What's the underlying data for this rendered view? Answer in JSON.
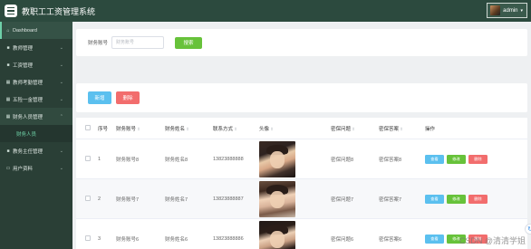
{
  "header": {
    "title": "教职工工资管理系统",
    "user": "admin",
    "caret": "▾"
  },
  "sidebar": {
    "items": [
      {
        "icon": "⌂",
        "label": "Dashboard",
        "chevron": ""
      },
      {
        "icon": "■",
        "label": "教师管理",
        "chevron": "⌄"
      },
      {
        "icon": "■",
        "label": "工资管理",
        "chevron": "⌄"
      },
      {
        "icon": "▦",
        "label": "教师考勤管理",
        "chevron": "⌄"
      },
      {
        "icon": "▦",
        "label": "五险一金管理",
        "chevron": "⌄"
      },
      {
        "icon": "▦",
        "label": "财务人员管理",
        "chevron": "⌃"
      },
      {
        "icon": "",
        "label": "财务人员",
        "chevron": ""
      },
      {
        "icon": "■",
        "label": "教务主任管理",
        "chevron": "⌄"
      },
      {
        "icon": "▭",
        "label": "用户资料",
        "chevron": "⌄"
      }
    ]
  },
  "search": {
    "label": "财务账号",
    "placeholder": "财务账号",
    "value": "",
    "button": "搜索"
  },
  "actions": {
    "add": "新增",
    "delete": "删除"
  },
  "table": {
    "sort_icon": "⇕",
    "columns": [
      "序号",
      "财务账号",
      "财务姓名",
      "联系方式",
      "头像",
      "密保问题",
      "密保答案",
      "操作"
    ],
    "rows": [
      {
        "no": "1",
        "account": "财务账号8",
        "name": "财务姓名8",
        "phone": "13823888888",
        "question": "密保问题8",
        "answer": "密保答案8"
      },
      {
        "no": "2",
        "account": "财务账号7",
        "name": "财务姓名7",
        "phone": "13823888887",
        "question": "密保问题7",
        "answer": "密保答案7"
      },
      {
        "no": "3",
        "account": "财务账号6",
        "name": "财务姓名6",
        "phone": "13823888886",
        "question": "密保问题6",
        "answer": "密保答案6"
      }
    ],
    "ops": {
      "view": "查看",
      "edit": "修改",
      "delete": "删除"
    }
  },
  "refresh_icon": "↻",
  "watermark": "CSDN @清清学姐"
}
